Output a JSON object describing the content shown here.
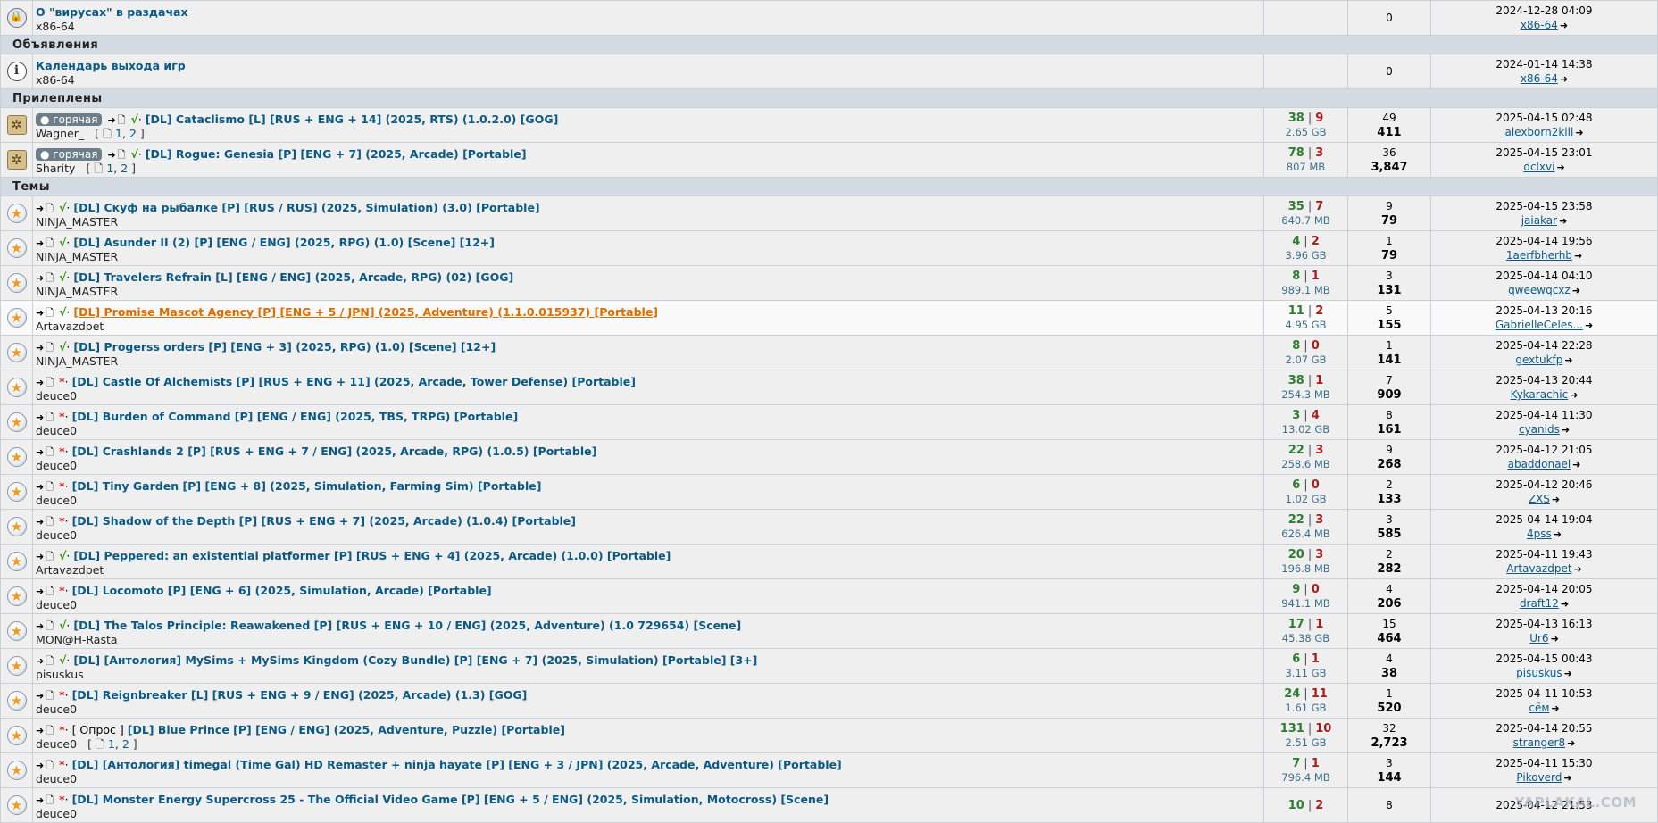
{
  "ui": {
    "dl_marker": "➜",
    "check": "√",
    "star": "*",
    "dot": "·",
    "sep": "|",
    "go": "➜",
    "hot": "● горячая",
    "poll": "[ Опрос ]",
    "watermark": "YAPLAKAL.COM"
  },
  "sections": {
    "announcements": "Объявления",
    "pinned": "Прилеплены",
    "topics": "Темы"
  },
  "rows": [
    {
      "icon": "lock-icon",
      "title": "О \"вирусах\" в раздачах",
      "author": "x86-64",
      "seeds": "",
      "leech": "",
      "size": "",
      "replies": "0",
      "views": "",
      "date": "2024-12-28 04:09",
      "user": "x86-64"
    },
    {
      "icon": "info-icon",
      "title": "Календарь выхода игр",
      "author": "x86-64",
      "seeds": "",
      "leech": "",
      "size": "",
      "replies": "0",
      "views": "",
      "date": "2024-01-14 14:38",
      "user": "x86-64"
    },
    {
      "icon": "pin-icon",
      "hot": true,
      "dl": true,
      "mark": "check",
      "title": "[DL] Cataclismo [L] [RUS + ENG + 14] (2025, RTS) (1.0.2.0) [GOG]",
      "author": "Wagner_",
      "pages": [
        "1",
        "2"
      ],
      "seeds": "38",
      "leech": "9",
      "size": "2.65 GB",
      "replies": "49",
      "views": "411",
      "date": "2025-04-15 02:48",
      "user": "alexborn2kill"
    },
    {
      "icon": "pin-icon",
      "hot": true,
      "dl": true,
      "mark": "check",
      "title": "[DL] Rogue: Genesia [P] [ENG + 7] (2025, Arcade) [Portable]",
      "author": "Sharity",
      "pages": [
        "1",
        "2"
      ],
      "seeds": "78",
      "leech": "3",
      "size": "807 MB",
      "replies": "36",
      "views": "3,847",
      "date": "2025-04-15 23:01",
      "user": "dclxvi"
    },
    {
      "icon": "star-icon",
      "dl": true,
      "mark": "check",
      "title": "[DL] Скуф на рыбалке [P] [RUS / RUS] (2025, Simulation) (3.0) [Portable]",
      "author": "NINJA_MASTER",
      "seeds": "35",
      "leech": "7",
      "size": "640.7 MB",
      "replies": "9",
      "views": "79",
      "date": "2025-04-15 23:58",
      "user": "jaiakar"
    },
    {
      "icon": "star-icon",
      "dl": true,
      "mark": "check",
      "title": "[DL] Asunder II (2) [P] [ENG / ENG] (2025, RPG) (1.0) [Scene] [12+]",
      "author": "NINJA_MASTER",
      "seeds": "4",
      "leech": "2",
      "size": "3.96 GB",
      "replies": "1",
      "views": "79",
      "date": "2025-04-14 19:56",
      "user": "1aerfbherhb"
    },
    {
      "icon": "star-icon",
      "dl": true,
      "mark": "check",
      "title": "[DL] Travelers Refrain [L] [ENG / ENG] (2025, Arcade, RPG) (02) [GOG]",
      "author": "NINJA_MASTER",
      "seeds": "8",
      "leech": "1",
      "size": "989.1 MB",
      "replies": "3",
      "views": "131",
      "date": "2025-04-14 04:10",
      "user": "qweewqcxz"
    },
    {
      "icon": "star-icon",
      "dl": true,
      "mark": "check",
      "hl": true,
      "title": "[DL] Promise Mascot Agency [P] [ENG + 5 / JPN] (2025, Adventure) (1.1.0.015937) [Portable]",
      "author": "Artavazdpet",
      "seeds": "11",
      "leech": "2",
      "size": "4.95 GB",
      "replies": "5",
      "views": "155",
      "date": "2025-04-13 20:16",
      "user": "GabrielleCeles..."
    },
    {
      "icon": "star-icon",
      "dl": true,
      "mark": "check",
      "title": "[DL] Progerss orders [P] [ENG + 3] (2025, RPG) (1.0) [Scene] [12+]",
      "author": "NINJA_MASTER",
      "seeds": "8",
      "leech": "0",
      "size": "2.07 GB",
      "replies": "1",
      "views": "141",
      "date": "2025-04-14 22:28",
      "user": "gextukfp"
    },
    {
      "icon": "star-icon",
      "dl": true,
      "mark": "star",
      "title": "[DL] Castle Of Alchemists [P] [RUS + ENG + 11] (2025, Arcade, Tower Defense) [Portable]",
      "author": "deuce0",
      "seeds": "38",
      "leech": "1",
      "size": "254.3 MB",
      "replies": "7",
      "views": "909",
      "date": "2025-04-13 20:44",
      "user": "Kykarachic"
    },
    {
      "icon": "star-icon",
      "dl": true,
      "mark": "star",
      "title": "[DL] Burden of Command [P] [ENG / ENG] (2025, TBS, TRPG) [Portable]",
      "author": "deuce0",
      "seeds": "3",
      "leech": "4",
      "size": "13.02 GB",
      "replies": "8",
      "views": "161",
      "date": "2025-04-14 11:30",
      "user": "cyanids"
    },
    {
      "icon": "star-icon",
      "dl": true,
      "mark": "star",
      "title": "[DL] Crashlands 2 [P] [RUS + ENG + 7 / ENG] (2025, Arcade, RPG) (1.0.5) [Portable]",
      "author": "deuce0",
      "seeds": "22",
      "leech": "3",
      "size": "258.6 MB",
      "replies": "9",
      "views": "268",
      "date": "2025-04-12 21:05",
      "user": "abaddonael"
    },
    {
      "icon": "star-icon",
      "dl": true,
      "mark": "star",
      "title": "[DL] Tiny Garden [P] [ENG + 8] (2025, Simulation, Farming Sim) [Portable]",
      "author": "deuce0",
      "seeds": "6",
      "leech": "0",
      "size": "1.02 GB",
      "replies": "2",
      "views": "133",
      "date": "2025-04-12 20:46",
      "user": "ZXS"
    },
    {
      "icon": "star-icon",
      "dl": true,
      "mark": "star",
      "title": "[DL] Shadow of the Depth [P] [RUS + ENG + 7] (2025, Arcade) (1.0.4) [Portable]",
      "author": "deuce0",
      "seeds": "22",
      "leech": "3",
      "size": "626.4 MB",
      "replies": "3",
      "views": "585",
      "date": "2025-04-14 19:04",
      "user": "4pss"
    },
    {
      "icon": "star-icon",
      "dl": true,
      "mark": "check",
      "title": "[DL] Peppered: an existential platformer [P] [RUS + ENG + 4] (2025, Arcade) (1.0.0) [Portable]",
      "author": "Artavazdpet",
      "seeds": "20",
      "leech": "3",
      "size": "196.8 MB",
      "replies": "2",
      "views": "282",
      "date": "2025-04-11 19:43",
      "user": "Artavazdpet"
    },
    {
      "icon": "star-icon",
      "dl": true,
      "mark": "star",
      "title": "[DL] Locomoto [P] [ENG + 6] (2025, Simulation, Arcade) [Portable]",
      "author": "deuce0",
      "seeds": "9",
      "leech": "0",
      "size": "941.1 MB",
      "replies": "4",
      "views": "206",
      "date": "2025-04-14 20:05",
      "user": "draft12"
    },
    {
      "icon": "star-icon",
      "dl": true,
      "mark": "check",
      "title": "[DL] The Talos Principle: Reawakened [P] [RUS + ENG + 10 / ENG] (2025, Adventure) (1.0 729654) [Scene]",
      "author": "MON@H-Rasta",
      "seeds": "17",
      "leech": "1",
      "size": "45.38 GB",
      "replies": "15",
      "views": "464",
      "date": "2025-04-13 16:13",
      "user": "Ur6"
    },
    {
      "icon": "star-icon",
      "dl": true,
      "mark": "check",
      "title": "[DL] [Антология] MySims + MySims Kingdom (Cozy Bundle) [P] [ENG + 7] (2025, Simulation) [Portable] [3+]",
      "author": "pisuskus",
      "seeds": "6",
      "leech": "1",
      "size": "3.11 GB",
      "replies": "4",
      "views": "38",
      "date": "2025-04-15 00:43",
      "user": "pisuskus"
    },
    {
      "icon": "star-icon",
      "dl": true,
      "mark": "star",
      "title": "[DL] Reignbreaker [L] [RUS + ENG + 9 / ENG] (2025, Arcade) (1.3) [GOG]",
      "author": "deuce0",
      "seeds": "24",
      "leech": "11",
      "size": "1.61 GB",
      "replies": "1",
      "views": "520",
      "date": "2025-04-11 10:53",
      "user": "сём"
    },
    {
      "icon": "star-icon",
      "dl": true,
      "mark": "star",
      "poll": true,
      "title": "[DL] Blue Prince [P] [ENG / ENG] (2025, Adventure, Puzzle) [Portable]",
      "author": "deuce0",
      "pages": [
        "1",
        "2"
      ],
      "seeds": "131",
      "leech": "10",
      "size": "2.51 GB",
      "replies": "32",
      "views": "2,723",
      "date": "2025-04-14 20:55",
      "user": "stranger8"
    },
    {
      "icon": "star-icon",
      "dl": true,
      "mark": "star",
      "title": "[DL] [Антология] timegal (Time Gal) HD Remaster + ninja hayate [P] [ENG + 3 / JPN] (2025, Arcade, Adventure) [Portable]",
      "author": "deuce0",
      "seeds": "7",
      "leech": "1",
      "size": "796.4 MB",
      "replies": "3",
      "views": "144",
      "date": "2025-04-11 15:30",
      "user": "Pikoverd"
    },
    {
      "icon": "star-icon",
      "dl": true,
      "mark": "star",
      "title": "[DL] Monster Energy Supercross 25 - The Official Video Game [P] [ENG + 5 / ENG] (2025, Simulation, Motocross) [Scene]",
      "author": "deuce0",
      "seeds": "10",
      "leech": "2",
      "size": "",
      "replies": "8",
      "views": "",
      "date": "2025-04-12 21:53",
      "user": ""
    }
  ]
}
